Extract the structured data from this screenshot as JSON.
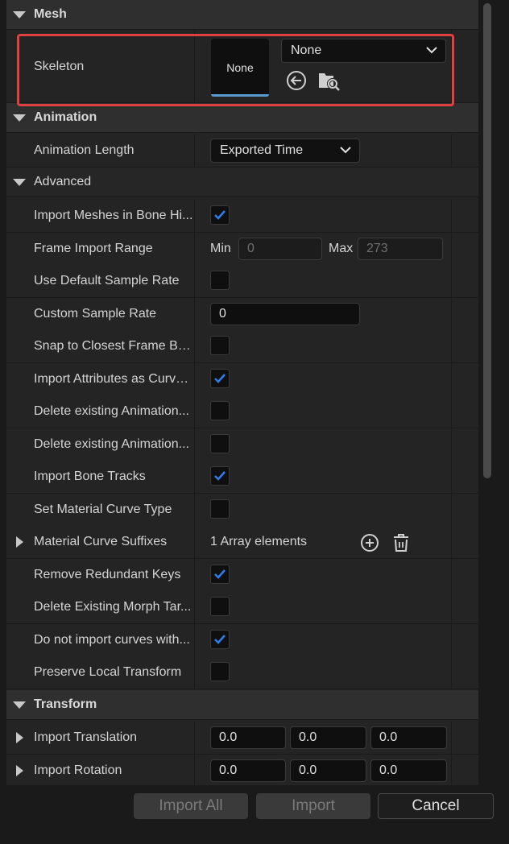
{
  "sections": {
    "mesh": "Mesh",
    "animation": "Animation",
    "advanced": "Advanced",
    "transform": "Transform"
  },
  "skeleton": {
    "label": "Skeleton",
    "thumbnail_text": "None",
    "combo_value": "None"
  },
  "animation_length": {
    "label": "Animation Length",
    "value": "Exported Time"
  },
  "advanced_rows": {
    "import_meshes": "Import Meshes in Bone Hi...",
    "frame_range": "Frame Import Range",
    "min_label": "Min",
    "min_value": "0",
    "max_label": "Max",
    "max_value": "273",
    "use_default_rate": "Use Default Sample Rate",
    "custom_rate": "Custom Sample Rate",
    "custom_rate_value": "0",
    "snap_frame": "Snap to Closest Frame Bo...",
    "import_attributes": "Import Attributes as Curve...",
    "delete_anim_1": "Delete existing Animation...",
    "delete_anim_2": "Delete existing Animation...",
    "import_bone_tracks": "Import Bone Tracks",
    "set_material_curve": "Set Material Curve Type",
    "material_suffixes": "Material Curve Suffixes",
    "array_elements": "1 Array elements",
    "remove_redundant": "Remove Redundant Keys",
    "delete_morph": "Delete Existing Morph Tar...",
    "do_not_import": "Do not import curves with...",
    "preserve_local": "Preserve Local Transform"
  },
  "checkbox_states": {
    "import_meshes": true,
    "use_default_rate": false,
    "snap_frame": false,
    "import_attributes": true,
    "delete_anim_1": false,
    "delete_anim_2": false,
    "import_bone_tracks": true,
    "set_material_curve": false,
    "remove_redundant": true,
    "delete_morph": false,
    "do_not_import": true,
    "preserve_local": false
  },
  "transform": {
    "translation_label": "Import Translation",
    "translation": [
      "0.0",
      "0.0",
      "0.0"
    ],
    "rotation_label": "Import Rotation",
    "rotation": [
      "0.0",
      "0.0",
      "0.0"
    ]
  },
  "footer": {
    "import_all": "Import All",
    "import": "Import",
    "cancel": "Cancel"
  },
  "colors": {
    "highlight_box": "#e04040",
    "checkmark": "#2f7be8",
    "thumbnail_accent": "#5a9ad0"
  }
}
